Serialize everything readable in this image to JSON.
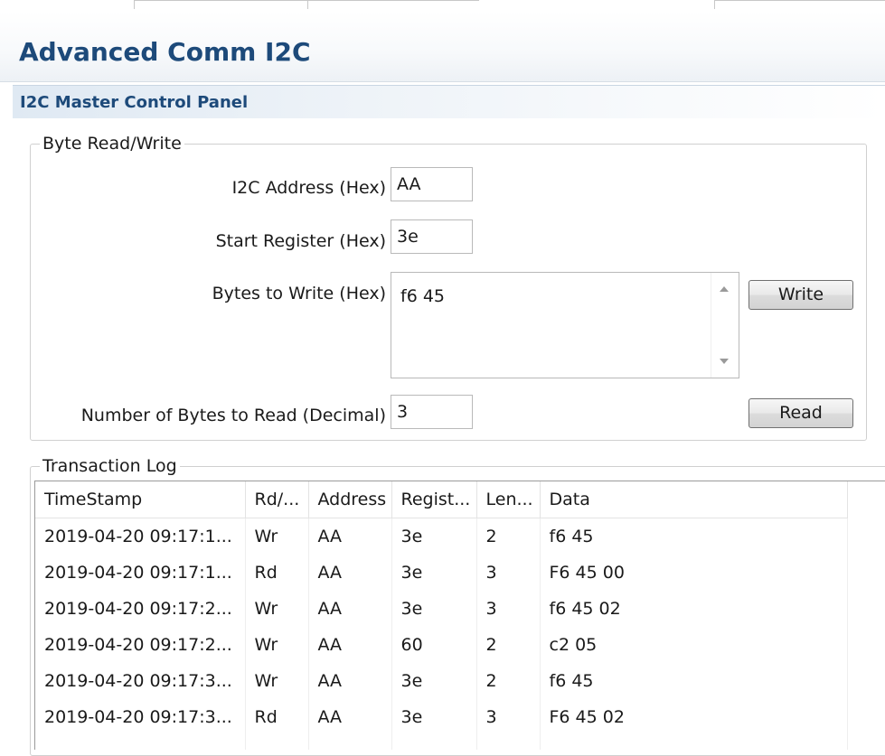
{
  "page": {
    "title": "Advanced Comm I2C",
    "section_title": "I2C Master Control Panel"
  },
  "byte_rw": {
    "legend": "Byte Read/Write",
    "address_label": "I2C Address (Hex)",
    "address_value": "AA",
    "start_register_label": "Start Register (Hex)",
    "start_register_value": "3e",
    "bytes_to_write_label": "Bytes to Write (Hex)",
    "bytes_to_write_value": "f6 45",
    "write_button": "Write",
    "num_bytes_label": "Number of Bytes to Read (Decimal)",
    "num_bytes_value": "3",
    "read_button": "Read"
  },
  "log": {
    "legend": "Transaction Log",
    "columns": [
      "TimeStamp",
      "Rd/...",
      "Address",
      "Regist...",
      "Len...",
      "Data"
    ],
    "rows": [
      [
        "2019-04-20 09:17:1...",
        "Wr",
        "AA",
        "3e",
        "2",
        "f6 45"
      ],
      [
        "2019-04-20 09:17:1...",
        "Rd",
        "AA",
        "3e",
        "3",
        "F6 45 00"
      ],
      [
        "2019-04-20 09:17:2...",
        "Wr",
        "AA",
        "3e",
        "3",
        "f6 45 02"
      ],
      [
        "2019-04-20 09:17:2...",
        "Wr",
        "AA",
        "60",
        "2",
        "c2 05"
      ],
      [
        "2019-04-20 09:17:3...",
        "Wr",
        "AA",
        "3e",
        "2",
        "f6 45"
      ],
      [
        "2019-04-20 09:17:3...",
        "Rd",
        "AA",
        "3e",
        "3",
        "F6 45 02"
      ],
      [
        "",
        "",
        "",
        "",
        "",
        ""
      ]
    ]
  }
}
